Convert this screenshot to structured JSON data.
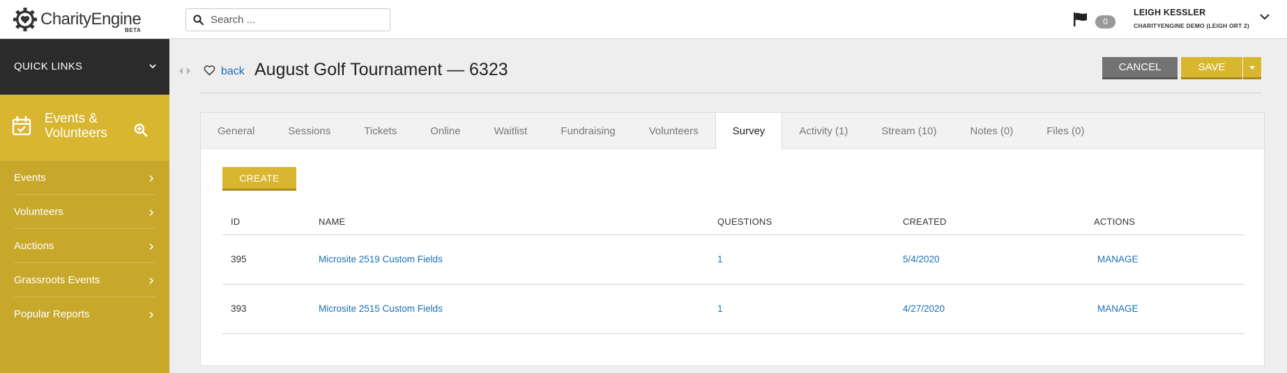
{
  "brand": {
    "name": "CharityEngine",
    "beta": "BETA"
  },
  "search": {
    "placeholder": "Search ..."
  },
  "notifications": {
    "count": "0"
  },
  "user": {
    "name": "LEIGH KESSLER",
    "org": "CHARITYENGINE DEMO (LEIGH ORT 2)"
  },
  "sidebar": {
    "quick_links": "QUICK LINKS",
    "section_title": "Events & Volunteers",
    "items": [
      {
        "label": "Events"
      },
      {
        "label": "Volunteers"
      },
      {
        "label": "Auctions"
      },
      {
        "label": "Grassroots Events"
      },
      {
        "label": "Popular Reports"
      }
    ]
  },
  "page": {
    "back": "back",
    "title": "August Golf Tournament — 6323",
    "cancel": "CANCEL",
    "save": "SAVE"
  },
  "tabs": [
    {
      "label": "General"
    },
    {
      "label": "Sessions"
    },
    {
      "label": "Tickets"
    },
    {
      "label": "Online"
    },
    {
      "label": "Waitlist"
    },
    {
      "label": "Fundraising"
    },
    {
      "label": "Volunteers"
    },
    {
      "label": "Survey",
      "active": true
    },
    {
      "label": "Activity (1)"
    },
    {
      "label": "Stream (10)"
    },
    {
      "label": "Notes (0)"
    },
    {
      "label": "Files (0)"
    }
  ],
  "survey": {
    "create": "CREATE",
    "columns": {
      "id": "ID",
      "name": "NAME",
      "questions": "QUESTIONS",
      "created": "CREATED",
      "actions": "ACTIONS"
    },
    "rows": [
      {
        "id": "395",
        "name": "Microsite 2519 Custom Fields",
        "questions": "1",
        "created": "5/4/2020",
        "action": "MANAGE"
      },
      {
        "id": "393",
        "name": "Microsite 2515 Custom Fields",
        "questions": "1",
        "created": "4/27/2020",
        "action": "MANAGE"
      }
    ]
  },
  "colors": {
    "accent": "#d9b630",
    "sidebar": "#c8a82b",
    "dark": "#2b2b2b",
    "link": "#1a6fb3",
    "cancel": "#737373"
  }
}
